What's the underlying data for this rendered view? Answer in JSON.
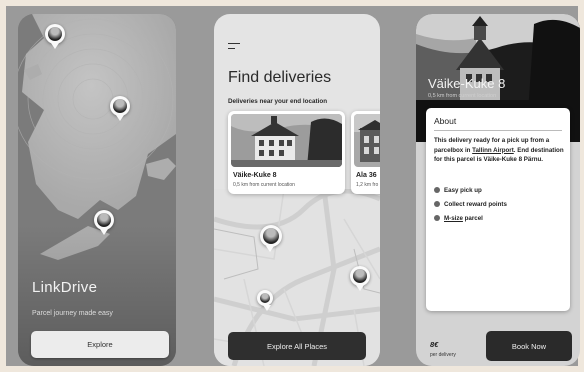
{
  "screen1": {
    "title": "LinkDrive",
    "tagline": "Parcel journey made easy",
    "explore_label": "Explore"
  },
  "screen2": {
    "title": "Find deliveries",
    "subtitle": "Deliveries near your end location",
    "cards": [
      {
        "title": "Väike-Kuke 8",
        "distance": "0,5 km from current location"
      },
      {
        "title": "Ala 36",
        "distance": "1,2 km fro"
      }
    ],
    "explore_all_label": "Explore All Places"
  },
  "screen3": {
    "title": "Väike-Kuke 8",
    "distance": "0,5 km from current location",
    "about_heading": "About",
    "about_pre": "This delivery ready for a pick up from a parcelbox in ",
    "about_link": "Tallinn Airport",
    "about_post": ". End destination for this parcel is Väike-Kuke 8 Pärnu.",
    "features": [
      "Easy pick up",
      "Collect reward points"
    ],
    "feature_link": "M-size",
    "feature_link_suffix": " parcel",
    "price": "8€",
    "price_unit": "per delivery",
    "book_label": "Book Now"
  },
  "colors": {
    "dark_button": "#2f2f2f",
    "light_button": "#ececec",
    "map_land": "#b9b9b9",
    "map_water": "#7b7b7b"
  }
}
